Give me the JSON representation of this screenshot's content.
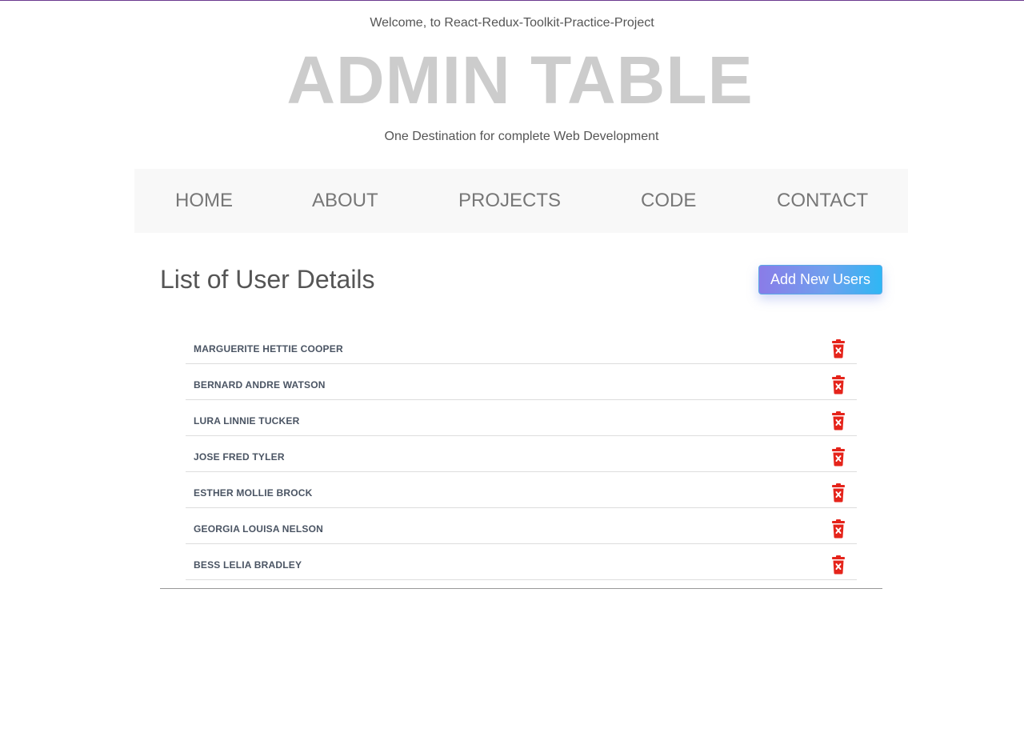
{
  "header": {
    "welcome": "Welcome, to React-Redux-Toolkit-Practice-Project",
    "title": "ADMIN TABLE",
    "tagline": "One Destination for complete Web Development"
  },
  "nav": {
    "items": [
      {
        "label": "HOME"
      },
      {
        "label": "ABOUT"
      },
      {
        "label": "PROJECTS"
      },
      {
        "label": "CODE"
      },
      {
        "label": "CONTACT"
      }
    ]
  },
  "main": {
    "section_title": "List of User Details",
    "add_button_label": "Add New Users",
    "users": [
      {
        "name": "MARGUERITE HETTIE COOPER"
      },
      {
        "name": "BERNARD ANDRE WATSON"
      },
      {
        "name": "LURA LINNIE TUCKER"
      },
      {
        "name": "JOSE FRED TYLER"
      },
      {
        "name": "ESTHER MOLLIE BROCK"
      },
      {
        "name": "GEORGIA LOUISA NELSON"
      },
      {
        "name": "BESS LELIA BRADLEY"
      }
    ],
    "delete_icon": "trash-delete-icon"
  },
  "colors": {
    "accent_start": "#8a7ce8",
    "accent_end": "#2fb7f4",
    "delete_red": "#e5241b",
    "title_gray": "#cccccc",
    "top_line": "#6b3a8f"
  }
}
